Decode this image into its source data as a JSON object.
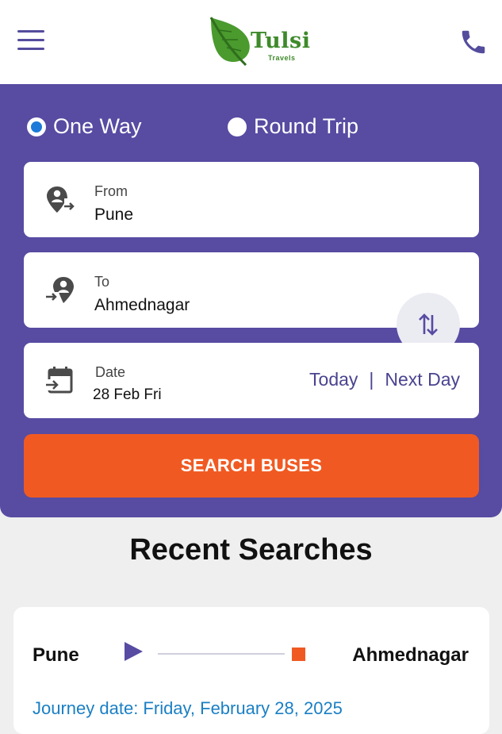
{
  "header": {
    "menu_icon": "hamburger-menu-icon",
    "logo_text": "Tulsi",
    "logo_subtext": "Travels",
    "phone_icon": "phone-icon",
    "brand_colors": {
      "primary": "#574ba2",
      "accent": "#f05a22",
      "logo_green": "#3f8a2b"
    }
  },
  "trip_type": {
    "options": [
      {
        "label": "One Way",
        "selected": true
      },
      {
        "label": "Round Trip",
        "selected": false
      }
    ]
  },
  "from": {
    "label": "From",
    "value": "Pune",
    "icon": "location-depart-icon"
  },
  "to": {
    "label": "To",
    "value": "Ahmednagar",
    "icon": "location-arrive-icon"
  },
  "swap_icon": "swap-vertical-icon",
  "date": {
    "label": "Date",
    "value": "28 Feb Fri",
    "icon": "calendar-icon",
    "today_label": "Today",
    "separator": "|",
    "next_day_label": "Next Day"
  },
  "search_button": {
    "label": "SEARCH BUSES"
  },
  "recent": {
    "title": "Recent Searches",
    "items": [
      {
        "from": "Pune",
        "to": "Ahmednagar",
        "journey_date": "Journey date: Friday, February 28, 2025"
      }
    ]
  }
}
